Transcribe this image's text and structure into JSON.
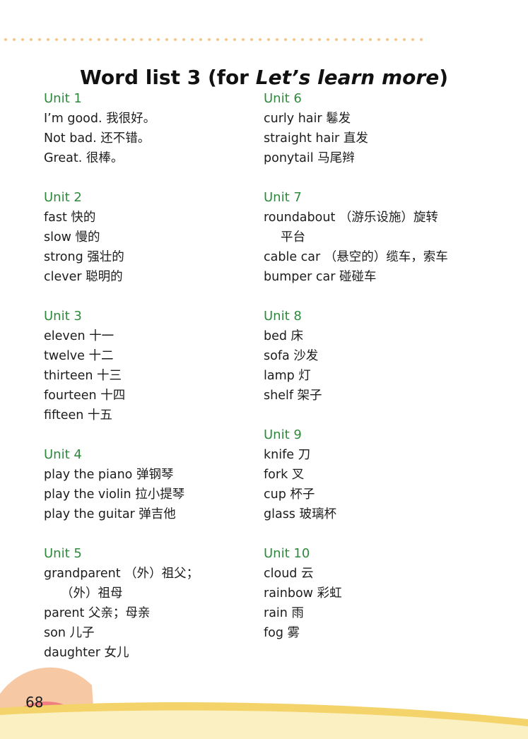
{
  "title": {
    "prefix": "Word list 3 (for ",
    "italic": "Let’s learn more",
    "suffix": ")"
  },
  "left_column": [
    {
      "unit": "Unit 1",
      "entries": [
        {
          "text": "I’m good. 我很好。"
        },
        {
          "text": "Not bad. 还不错。"
        },
        {
          "text": "Great. 很棒。"
        }
      ]
    },
    {
      "unit": "Unit 2",
      "entries": [
        {
          "text": "fast 快的"
        },
        {
          "text": "slow 慢的"
        },
        {
          "text": "strong 强壮的"
        },
        {
          "text": "clever 聪明的"
        }
      ]
    },
    {
      "unit": "Unit 3",
      "entries": [
        {
          "text": "eleven 十一"
        },
        {
          "text": "twelve 十二"
        },
        {
          "text": "thirteen 十三"
        },
        {
          "text": "fourteen 十四"
        },
        {
          "text": "fifteen 十五"
        }
      ]
    },
    {
      "unit": "Unit 4",
      "entries": [
        {
          "text": "play the piano 弹钢琴"
        },
        {
          "text": "play the violin 拉小提琴"
        },
        {
          "text": "play the guitar 弹吉他"
        }
      ]
    },
    {
      "unit": "Unit 5",
      "entries": [
        {
          "text": "grandparent （外）祖父；",
          "cont": "（外）祖母"
        },
        {
          "text": "parent 父亲；母亲"
        },
        {
          "text": "son 儿子"
        },
        {
          "text": "daughter 女儿"
        }
      ]
    }
  ],
  "right_column": [
    {
      "unit": "Unit 6",
      "entries": [
        {
          "text": "curly hair 鬈发"
        },
        {
          "text": "straight hair 直发"
        },
        {
          "text": "ponytail 马尾辫"
        }
      ]
    },
    {
      "unit": "Unit 7",
      "entries": [
        {
          "text": "roundabout （游乐设施）旋转",
          "cont": "平台"
        },
        {
          "text": "cable car （悬空的）缆车，索车"
        },
        {
          "text": "bumper car 碰碰车"
        }
      ]
    },
    {
      "unit": "Unit 8",
      "entries": [
        {
          "text": "bed 床"
        },
        {
          "text": "sofa 沙发"
        },
        {
          "text": "lamp 灯"
        },
        {
          "text": "shelf 架子"
        }
      ]
    },
    {
      "unit": "Unit 9",
      "entries": [
        {
          "text": "knife 刀"
        },
        {
          "text": "fork 叉"
        },
        {
          "text": "cup 杯子"
        },
        {
          "text": "glass 玻璃杯"
        }
      ]
    },
    {
      "unit": "Unit 10",
      "entries": [
        {
          "text": "cloud 云"
        },
        {
          "text": "rainbow 彩虹"
        },
        {
          "text": "rain 雨"
        },
        {
          "text": "fog 雾"
        }
      ]
    }
  ],
  "page_number": "68",
  "colors": {
    "unit_heading": "#2e8a3c",
    "dots": "#f6c58a",
    "footer_sun": "#f7c8a4",
    "footer_stripe": "#f3d36a",
    "footer_base": "#fbf0c2",
    "page_circle": "#f07d80"
  }
}
